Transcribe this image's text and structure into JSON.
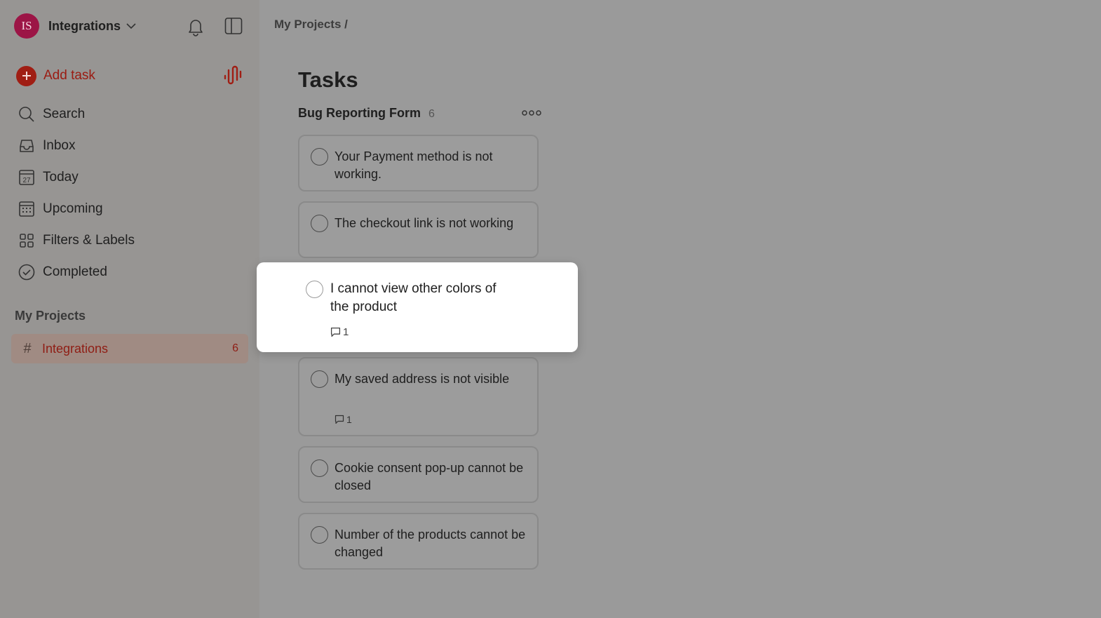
{
  "workspace": {
    "initials": "IS",
    "name": "Integrations"
  },
  "sidebar": {
    "add_task_label": "Add task",
    "nav": [
      {
        "label": "Search",
        "icon": "search-icon"
      },
      {
        "label": "Inbox",
        "icon": "inbox-icon"
      },
      {
        "label": "Today",
        "icon": "calendar-today-icon",
        "icon_text": "27"
      },
      {
        "label": "Upcoming",
        "icon": "calendar-grid-icon"
      },
      {
        "label": "Filters & Labels",
        "icon": "grid-icon"
      },
      {
        "label": "Completed",
        "icon": "check-circle-icon"
      }
    ],
    "projects_title": "My Projects",
    "projects": [
      {
        "label": "Integrations",
        "count": "6"
      }
    ]
  },
  "main": {
    "breadcrumb": "My Projects /",
    "title": "Tasks",
    "section": {
      "name": "Bug Reporting Form",
      "count": "6"
    },
    "tasks": [
      {
        "title": "Your Payment method is not working.",
        "comments": ""
      },
      {
        "title": "The checkout link is not working",
        "comments": ""
      },
      {
        "title": "My saved address is not visible",
        "comments": "1"
      },
      {
        "title": "Cookie consent pop-up cannot be closed",
        "comments": ""
      },
      {
        "title": "Number of the products cannot be changed",
        "comments": ""
      }
    ],
    "dragging_task": {
      "title": "I cannot view other colors of the product",
      "comments": "1"
    }
  },
  "colors": {
    "accent": "#9b1b12",
    "avatar": "#9c1546",
    "overlay": "#9a9a9a"
  }
}
